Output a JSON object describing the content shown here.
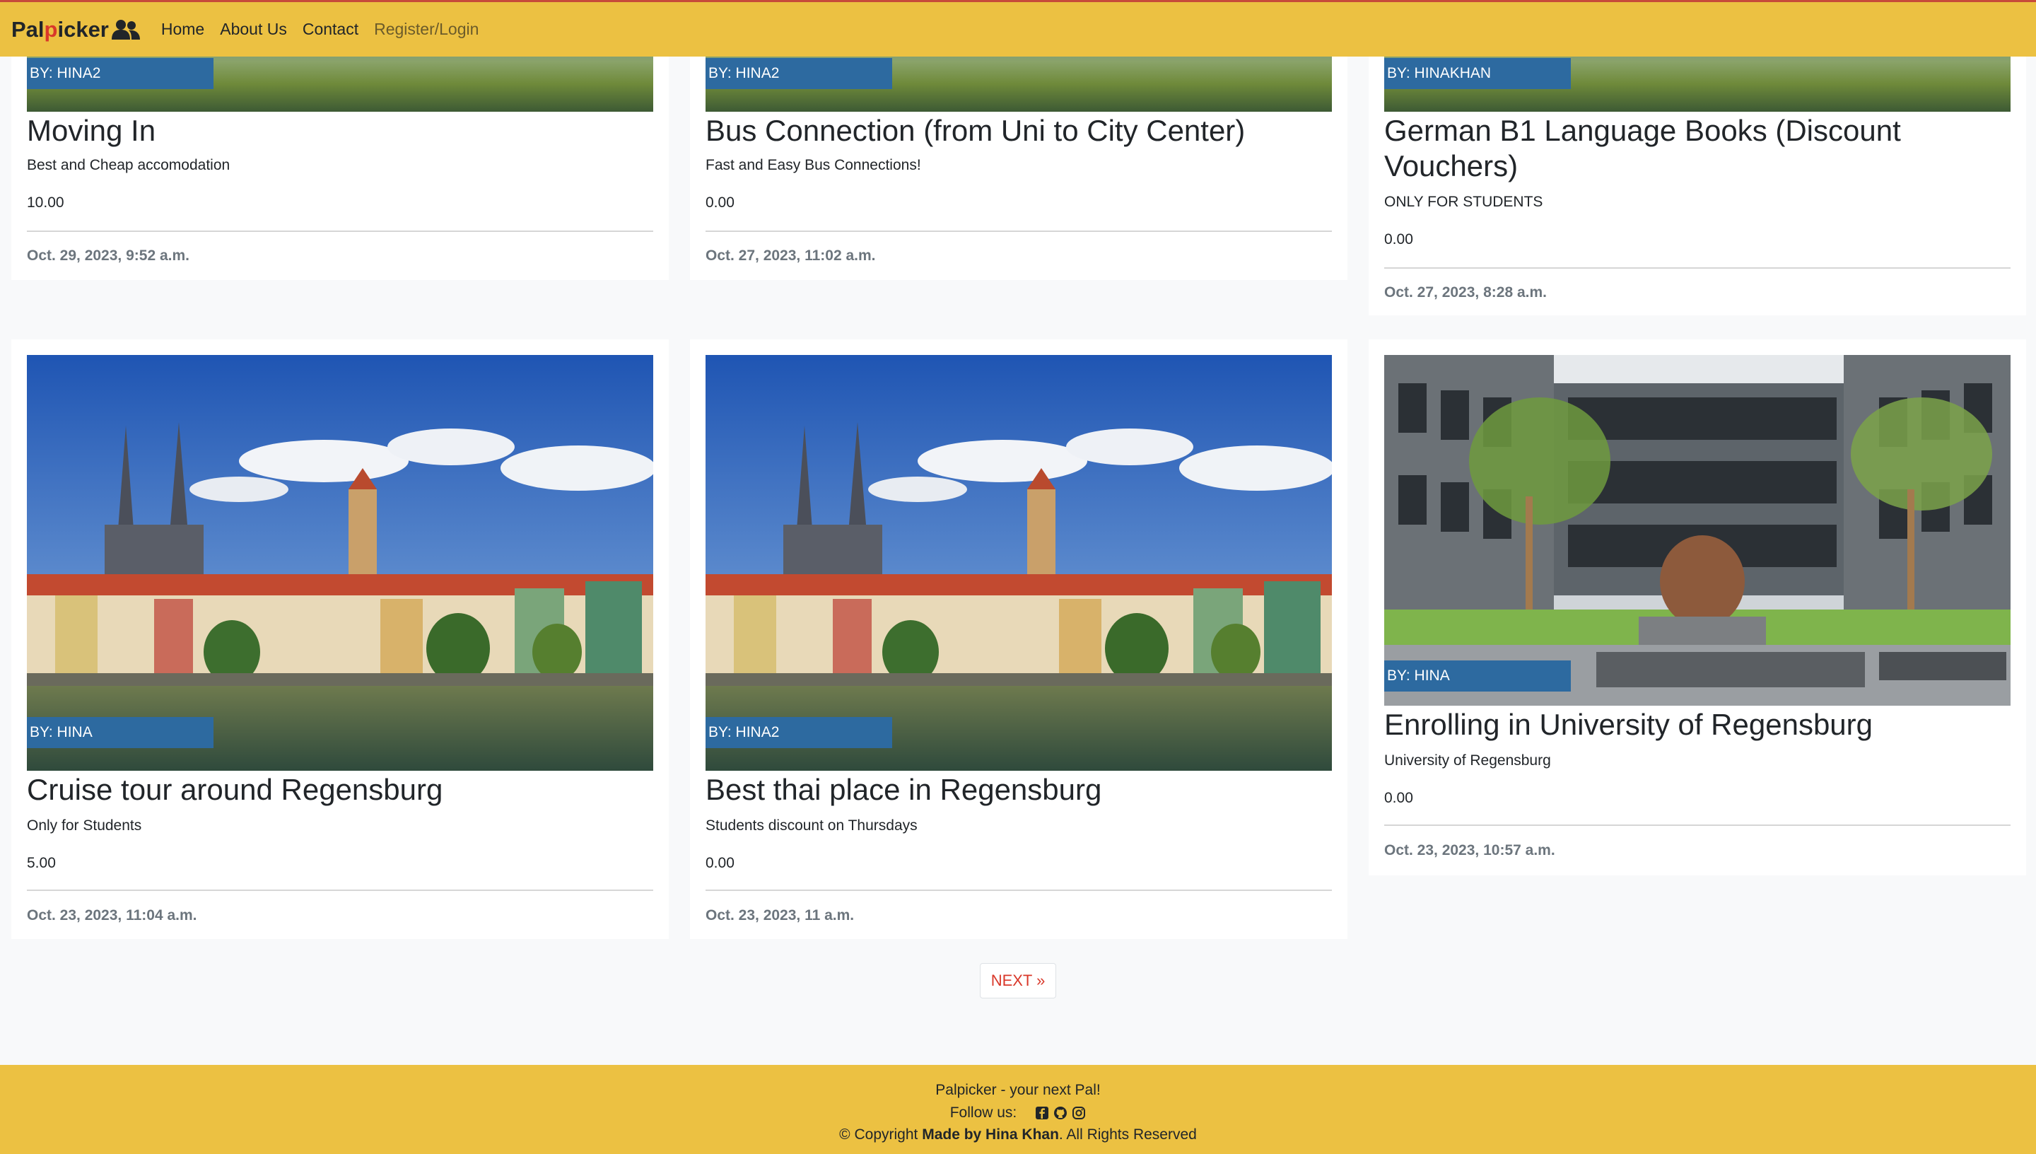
{
  "nav": {
    "brand_part1": "Pal",
    "brand_part2": "p",
    "brand_part3": "icker",
    "home": "Home",
    "about": "About Us",
    "contact": "Contact",
    "register": "Register/Login"
  },
  "row1": [
    {
      "author": "BY: HINA2",
      "title": "Moving In",
      "desc": "Best and Cheap accomodation",
      "price": "10.00",
      "date": "Oct. 29, 2023, 9:52 a.m."
    },
    {
      "author": "BY: HINA2",
      "title": "Bus Connection (from Uni to City Center)",
      "desc": "Fast and Easy Bus Connections!",
      "price": "0.00",
      "date": "Oct. 27, 2023, 11:02 a.m."
    },
    {
      "author": "BY: HINAKHAN",
      "title": "German B1 Language Books (Discount Vouchers)",
      "desc": "ONLY FOR STUDENTS",
      "price": "0.00",
      "date": "Oct. 27, 2023, 8:28 a.m."
    }
  ],
  "row2": [
    {
      "author": "BY: HINA",
      "title": "Cruise tour around Regensburg",
      "desc": "Only for Students",
      "price": "5.00",
      "date": "Oct. 23, 2023, 11:04 a.m."
    },
    {
      "author": "BY: HINA2",
      "title": "Best thai place in Regensburg",
      "desc": "Students discount on Thursdays",
      "price": "0.00",
      "date": "Oct. 23, 2023, 11 a.m."
    },
    {
      "author": "BY: HINA",
      "title": "Enrolling in University of Regensburg",
      "desc": "University of Regensburg",
      "price": "0.00",
      "date": "Oct. 23, 2023, 10:57 a.m."
    }
  ],
  "pagination": {
    "next": "NEXT »"
  },
  "footer": {
    "tagline": "Palpicker - your next Pal!",
    "follow": "Follow us:",
    "copyright_prefix": "© Copyright",
    "copyright_bold": "Made by Hina Khan",
    "copyright_suffix": ". All Rights Reserved",
    "icons": [
      "facebook-icon",
      "github-icon",
      "instagram-icon"
    ]
  },
  "colors": {
    "navbar": "#ecc142",
    "brand_accent": "#d9382a",
    "author_tag": "#2d6aa0"
  }
}
